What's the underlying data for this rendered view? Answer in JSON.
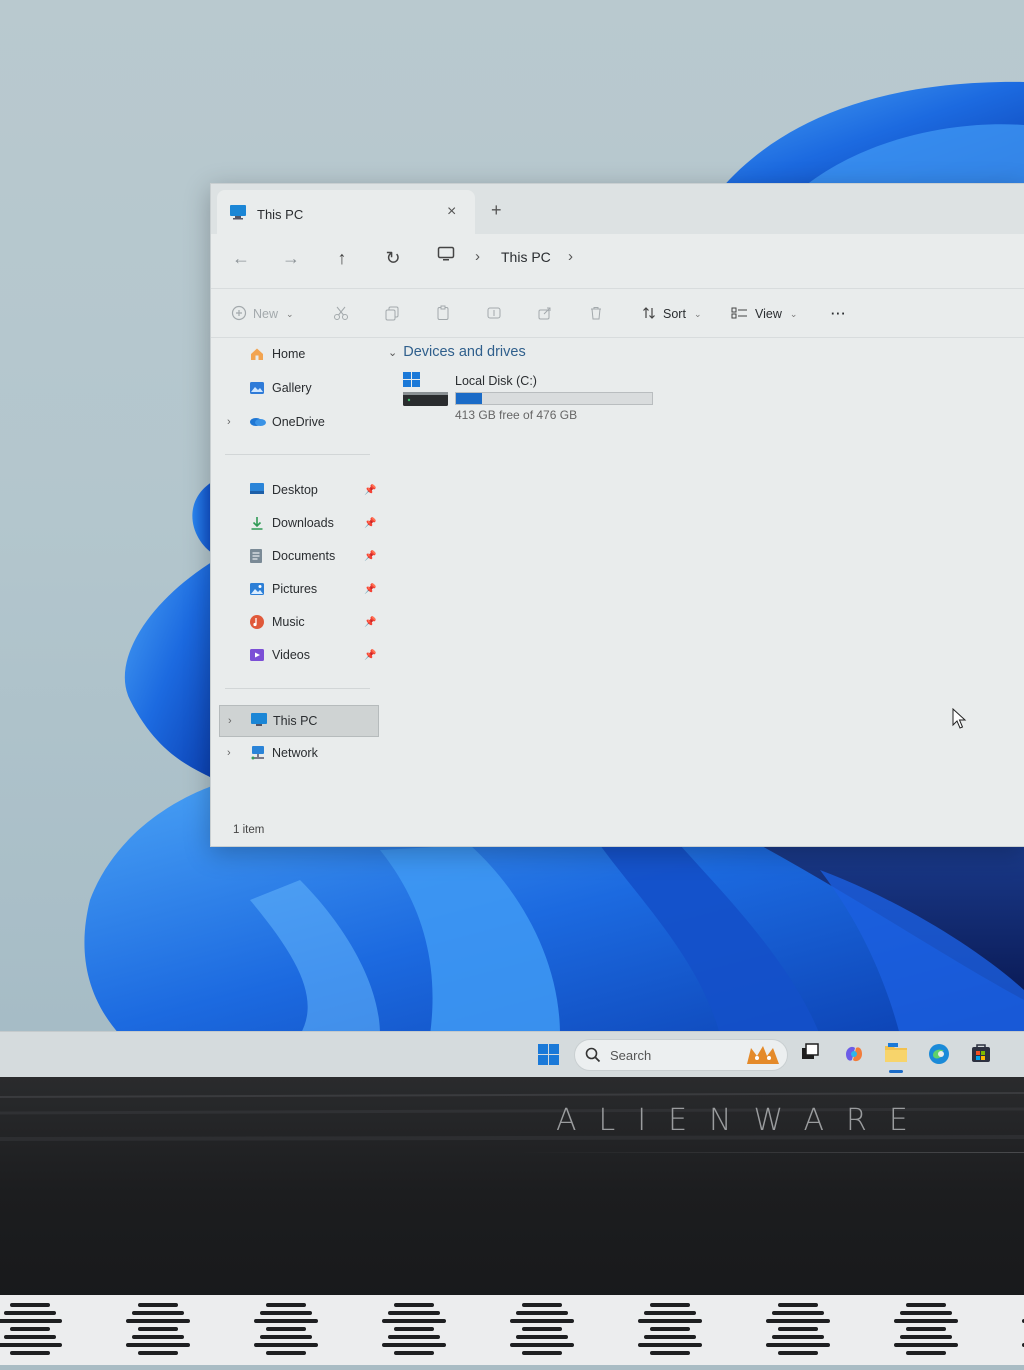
{
  "window": {
    "tab_title": "This PC",
    "tab_close": "×",
    "new_tab": "+"
  },
  "nav": {
    "back": "←",
    "forward": "→",
    "up": "↑",
    "refresh": "↻",
    "breadcrumb": [
      "This PC"
    ],
    "separator": "›"
  },
  "commandbar": {
    "new_label": "New",
    "sort_label": "Sort",
    "view_label": "View",
    "more": "···"
  },
  "sidebar": {
    "top": [
      {
        "label": "Home",
        "icon": "home-icon"
      },
      {
        "label": "Gallery",
        "icon": "gallery-icon"
      },
      {
        "label": "OneDrive",
        "icon": "onedrive-icon"
      }
    ],
    "pinned": [
      {
        "label": "Desktop",
        "icon": "desktop-icon"
      },
      {
        "label": "Downloads",
        "icon": "downloads-icon"
      },
      {
        "label": "Documents",
        "icon": "documents-icon"
      },
      {
        "label": "Pictures",
        "icon": "pictures-icon"
      },
      {
        "label": "Music",
        "icon": "music-icon"
      },
      {
        "label": "Videos",
        "icon": "videos-icon"
      }
    ],
    "bottom": [
      {
        "label": "This PC",
        "icon": "this-pc-icon",
        "selected": true
      },
      {
        "label": "Network",
        "icon": "network-icon"
      }
    ]
  },
  "main": {
    "group_header": "Devices and drives",
    "drives": [
      {
        "name": "Local Disk (C:)",
        "free_text": "413 GB free of 476 GB",
        "used_fraction": 0.132
      }
    ]
  },
  "status": {
    "item_count": "1 item"
  },
  "taskbar": {
    "search_placeholder": "Search"
  },
  "device": {
    "brand": "ALIENWARE"
  },
  "colors": {
    "accent": "#1a6bc7",
    "wallpaper_bloom": "#1f6fe0",
    "window_bg": "#e9ecec"
  }
}
